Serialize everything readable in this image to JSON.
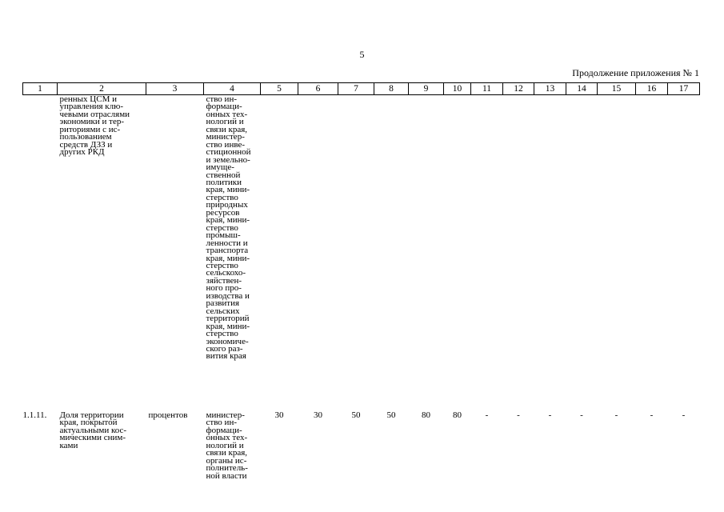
{
  "page_number": "5",
  "continuation": "Продолжение приложения № 1",
  "table": {
    "headers": [
      "1",
      "2",
      "3",
      "4",
      "5",
      "6",
      "7",
      "8",
      "9",
      "10",
      "11",
      "12",
      "13",
      "14",
      "15",
      "16",
      "17"
    ],
    "rows": [
      {
        "c1": "",
        "c2": "ренных ЦСМ и\nуправления клю-\nчевыми отраслями\nэкономики и тер-\nриториями с ис-\nпользованием\nсредств ДЗЗ и\nдругих РКД",
        "c3": "",
        "c4": "ство ин-\nформаци-\nонных тех-\nнологий и\nсвязи края,\nминистер-\nство инве-\nстиционной\nи земельно-\nимуще-\nственной\nполитики\nкрая, мини-\nстерство\nприродных\nресурсов\nкрая, мини-\nстерство\nпромыш-\nленности и\nтранспорта\nкрая, мини-\nстерство\nсельскохо-\nзяйствен-\nного про-\nизводства и\nразвития\nсельских\nтерриторий\nкрая, мини-\nстерство\nэкономиче-\nского раз-\nвития края",
        "values": [
          "",
          "",
          "",
          "",
          "",
          "",
          "",
          "",
          "",
          "",
          "",
          "",
          ""
        ]
      },
      {
        "c1": "1.1.11.",
        "c2": "Доля территории\nкрая, покрытой\nактуальными кос-\nмическими сним-\nками",
        "c3": "процентов",
        "c4": "министер-\nство ин-\nформаци-\nонных тех-\nнологий и\nсвязи края,\nорганы ис-\nполнитель-\nной власти",
        "values": [
          "30",
          "30",
          "50",
          "50",
          "80",
          "80",
          "-",
          "-",
          "-",
          "-",
          "-",
          "-",
          "-"
        ]
      }
    ]
  }
}
